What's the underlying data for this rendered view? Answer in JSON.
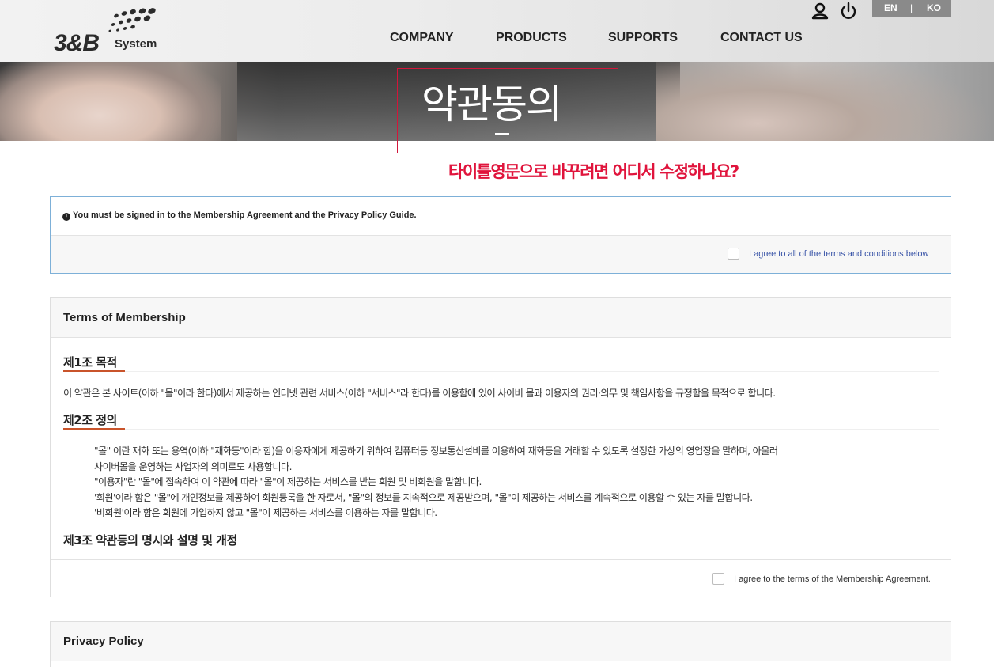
{
  "header": {
    "logo": {
      "mark": "3&B",
      "subtitle": "System"
    },
    "nav": [
      "COMPANY",
      "PRODUCTS",
      "SUPPORTS",
      "CONTACT US"
    ],
    "icons": [
      "user-icon",
      "power-icon"
    ],
    "lang": {
      "en": "EN",
      "separator": "|",
      "ko": "KO"
    }
  },
  "banner": {
    "title": "약관동의"
  },
  "annotation": {
    "text": "타이틀영문으로 바꾸려면 어디서 수정하나요?",
    "color": "#e0143c"
  },
  "notice": {
    "icon": "info-icon",
    "message": "You must be signed in to the Membership Agreement and the Privacy Policy Guide.",
    "agree_all_label": "I agree to all of the terms and conditions below"
  },
  "terms": {
    "title": "Terms of Membership",
    "article1": {
      "heading": "제1조 목적",
      "text": "이 약관은 본 사이트(이하 \"몰\"이라 한다)에서 제공하는 인터넷 관련 서비스(이하 \"서비스\"라 한다)를 이용함에 있어 사이버 몰과 이용자의 권리·의무 및 책임사항을 규정함을 목적으로 합니다."
    },
    "article2": {
      "heading": "제2조 정의",
      "lines": [
        "\"몰\" 이란 재화 또는 용역(이하 \"재화등\"이라 함)을 이용자에게 제공하기 위하여 컴퓨터등 정보통신설비를 이용하여 재화등을 거래할 수 있도록 설정한 가상의 영업장을 말하며, 아울러",
        "사이버몰을 운영하는 사업자의 의미로도 사용합니다.",
        "\"이용자\"란 \"몰\"에 접속하여 이 약관에 따라 \"몰\"이 제공하는 서비스를 받는 회원 및 비회원을 말합니다.",
        "'회원'이라 함은 \"몰\"에 개인정보를 제공하여 회원등록을 한 자로서, \"몰\"의 정보를 지속적으로 제공받으며, \"몰\"이 제공하는 서비스를 계속적으로 이용할 수 있는 자를 말합니다.",
        "'비회원'이라 함은 회원에 가입하지 않고 \"몰\"이 제공하는 서비스를 이용하는 자를 말합니다."
      ]
    },
    "article3": {
      "heading": "제3조 약관등의 명시와 설명 및 개정"
    },
    "agree_label": "I agree to the terms of the Membership Agreement."
  },
  "privacy": {
    "title": "Privacy Policy"
  }
}
